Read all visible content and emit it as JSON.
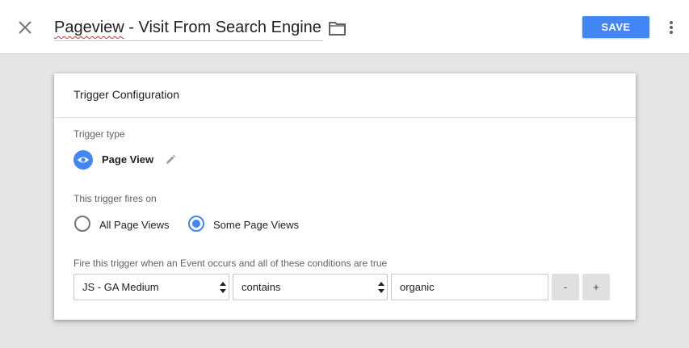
{
  "header": {
    "title_word_misspelled": "Pageview",
    "title_rest": " - Visit From Search Engine",
    "save_label": "SAVE",
    "close_icon": "close-icon",
    "folder_icon": "folder-icon",
    "more_icon": "more-vert-icon"
  },
  "card": {
    "title": "Trigger Configuration",
    "trigger_type_label": "Trigger type",
    "trigger_type": {
      "name": "Page View",
      "icon": "eye-icon",
      "edit_icon": "pencil-icon"
    },
    "fires_on_label": "This trigger fires on",
    "fires_on_options": [
      {
        "label": "All Page Views",
        "selected": false
      },
      {
        "label": "Some Page Views",
        "selected": true
      }
    ],
    "condition_label": "Fire this trigger when an Event occurs and all of these conditions are true",
    "condition": {
      "variable": "JS - GA Medium",
      "operator": "contains",
      "value": "organic"
    },
    "remove_label": "-",
    "add_label": "+"
  },
  "colors": {
    "accent": "#4285f4",
    "background": "#e5e5e5"
  }
}
